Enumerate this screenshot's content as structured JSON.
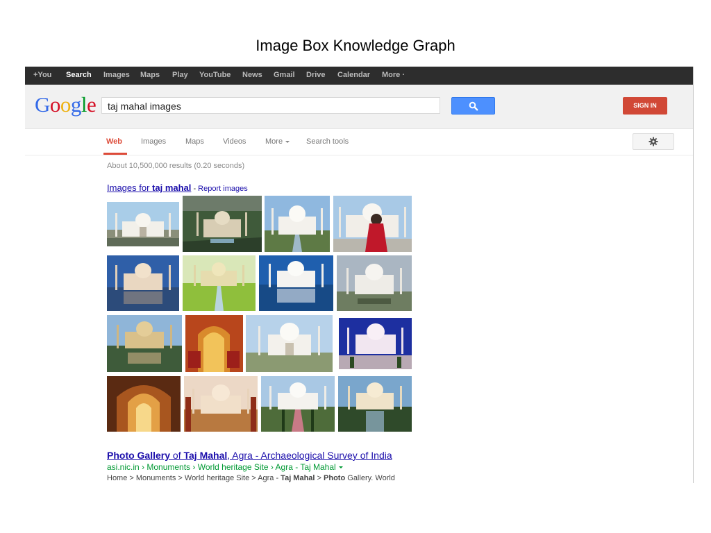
{
  "slide_title": "Image Box Knowledge Graph",
  "topbar": {
    "items": [
      "+You",
      "Search",
      "Images",
      "Maps",
      "Play",
      "YouTube",
      "News",
      "Gmail",
      "Drive",
      "Calendar",
      "More ·"
    ],
    "active": "Search"
  },
  "logo": {
    "letters": [
      "G",
      "o",
      "o",
      "g",
      "l",
      "e"
    ],
    "colors": [
      "#3369e8",
      "#d50f25",
      "#eeb211",
      "#3369e8",
      "#009925",
      "#d50f25"
    ]
  },
  "search": {
    "query": "taj mahal images",
    "button_icon": "search-icon"
  },
  "signin_label": "SIGN IN",
  "tabs": {
    "web": "Web",
    "images": "Images",
    "maps": "Maps",
    "videos": "Videos",
    "more": "More",
    "search_tools": "Search tools"
  },
  "settings_icon": "gear-icon",
  "stats": "About 10,500,000 results (0.20 seconds)",
  "image_box": {
    "link_prefix": "Images for ",
    "link_bold": "taj mahal",
    "separator": " - ",
    "report": "Report images"
  },
  "result": {
    "title_parts": [
      "Photo Gallery",
      " of ",
      "Taj Mahal",
      ", Agra - Archaeological Survey of India"
    ],
    "url": "asi.nic.in › Monuments › World heritage Site › Agra - Taj Mahal",
    "snippet_parts": [
      "Home > Monuments > World heritage Site > Agra - ",
      "Taj Mahal",
      " > ",
      "Photo",
      " Gallery. World"
    ]
  },
  "colors": {
    "topbar_bg": "#2d2d2d",
    "link": "#1a0dab",
    "url_green": "#009933",
    "active_tab": "#dd4b39",
    "search_button": "#4d90fe",
    "signin_button": "#d14836"
  }
}
